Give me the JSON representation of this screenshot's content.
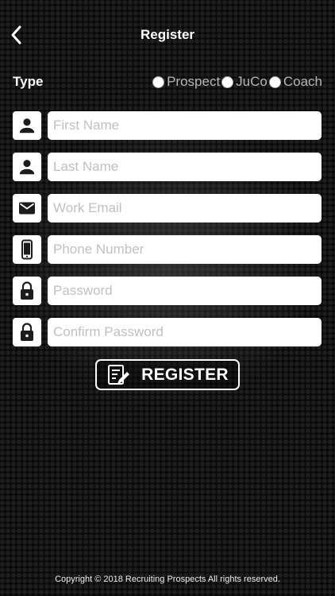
{
  "header": {
    "title": "Register",
    "back_icon": "chevron-left-icon"
  },
  "type_selector": {
    "label": "Type",
    "options": [
      {
        "label": "Prospect",
        "selected": false
      },
      {
        "label": "JuCo",
        "selected": false
      },
      {
        "label": "Coach",
        "selected": false
      }
    ]
  },
  "form": {
    "fields": [
      {
        "icon": "person-icon",
        "placeholder": "First Name",
        "value": ""
      },
      {
        "icon": "person-icon",
        "placeholder": "Last Name",
        "value": ""
      },
      {
        "icon": "envelope-icon",
        "placeholder": "Work Email",
        "value": ""
      },
      {
        "icon": "phone-icon",
        "placeholder": "Phone Number",
        "value": ""
      },
      {
        "icon": "lock-icon",
        "placeholder": "Password",
        "value": ""
      },
      {
        "icon": "lock-icon",
        "placeholder": "Confirm Password",
        "value": ""
      }
    ]
  },
  "register_button": {
    "label": "REGISTER",
    "icon": "signup-form-icon"
  },
  "footer": {
    "copyright": "Copyright © 2018 Recruiting Prospects All rights reserved."
  },
  "colors": {
    "background": "#0a0a0a",
    "field_background": "#ffffff",
    "placeholder": "#c0c0c0",
    "icon": "#1c1c1c"
  }
}
